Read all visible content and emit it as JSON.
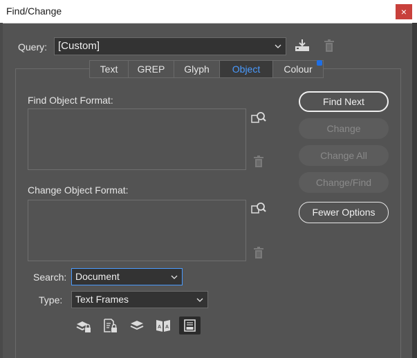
{
  "window": {
    "title": "Find/Change",
    "close_glyph": "×"
  },
  "query": {
    "label": "Query:",
    "value": "[Custom]",
    "save_icon": "save-query-icon",
    "delete_icon": "delete-query-icon"
  },
  "tabs": [
    {
      "label": "Text",
      "active": false
    },
    {
      "label": "GREP",
      "active": false
    },
    {
      "label": "Glyph",
      "active": false
    },
    {
      "label": "Object",
      "active": true
    },
    {
      "label": "Colour",
      "active": false,
      "indicator_color": "#1e6fe6"
    }
  ],
  "find_format": {
    "label": "Find Object Format:"
  },
  "change_format": {
    "label": "Change Object Format:"
  },
  "buttons": {
    "find_next": "Find Next",
    "change": "Change",
    "change_all": "Change All",
    "change_find": "Change/Find",
    "fewer_options": "Fewer Options"
  },
  "search": {
    "label": "Search:",
    "value": "Document"
  },
  "type": {
    "label": "Type:",
    "value": "Text Frames"
  },
  "options": [
    {
      "name": "include-locked-layers",
      "active": false
    },
    {
      "name": "include-locked-objects",
      "active": false
    },
    {
      "name": "include-hidden-layers",
      "active": false
    },
    {
      "name": "include-master-pages",
      "active": false
    },
    {
      "name": "include-footnotes",
      "active": true
    }
  ],
  "colors": {
    "accent": "#4a9bff",
    "background": "#535353",
    "close": "#c8403b"
  }
}
